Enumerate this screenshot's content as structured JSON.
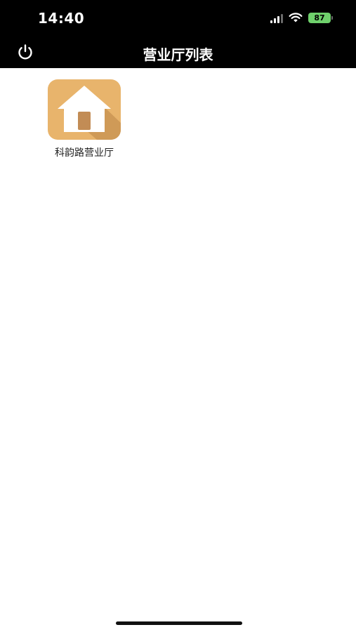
{
  "status_bar": {
    "time": "14:40",
    "battery": "87"
  },
  "nav": {
    "title": "营业厅列表"
  },
  "halls": [
    {
      "label": "科韵路营业厅"
    }
  ],
  "colors": {
    "bar_background": "#000000",
    "icon_background": "#e8b46c",
    "icon_shadow": "#cf9a57",
    "icon_door": "#c28c55",
    "battery_fill": "#6fd16c"
  }
}
